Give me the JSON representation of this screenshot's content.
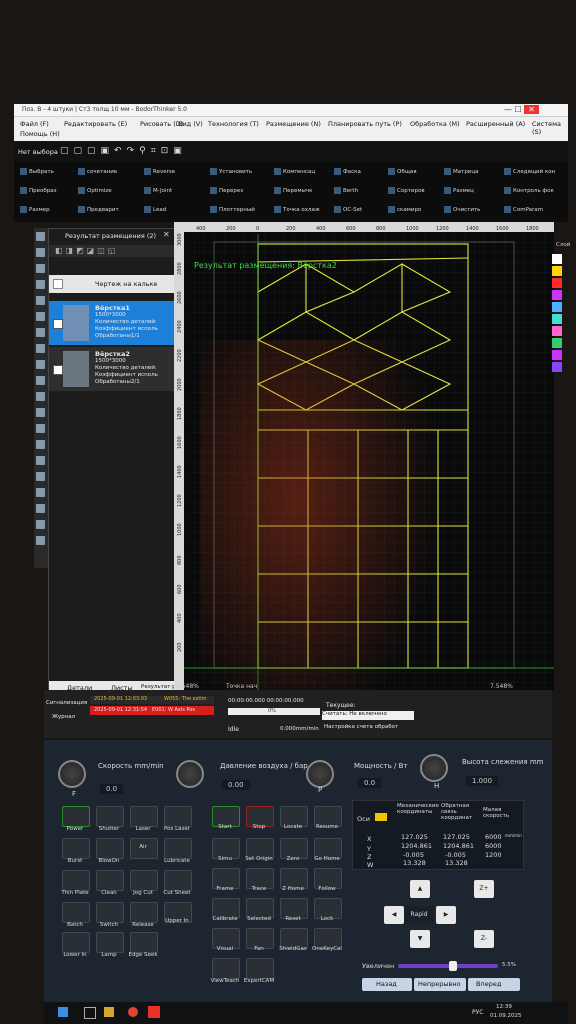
{
  "window_title": "Поз. В - 4 штуки | Ст3 толщ 10 мм - BodorThinker 5.0",
  "menu": [
    "Файл (F)",
    "Редактировать (E)",
    "Рисовать (D)",
    "Вид (V)",
    "Технология (T)",
    "Размещение (N)",
    "Планировать путь (P)",
    "Обработка (M)",
    "Расширенный (A)",
    "Система (S)",
    "Помощь (H)"
  ],
  "toolbar1": {
    "selection_label": "Нет выбора"
  },
  "ribbon": [
    [
      "Выбрать",
      "сочетание",
      "Reverse",
      "Установить",
      "Компенсац",
      "Фаска",
      "Общая",
      "Матрица",
      "Следящий кон"
    ],
    [
      "Преобраз",
      "Optimize",
      "M-Joint",
      "Перерез",
      "Перемычк",
      "Berth",
      "Сортиров",
      "Размец",
      "Контроль фок"
    ],
    [
      "Размер",
      "Предварит",
      "Lead",
      "Плоттерный",
      "Точка охлаж",
      "OC-Set",
      "скамиро",
      "Очистить",
      "ComParam"
    ]
  ],
  "panel": {
    "title": "Результат размещения (2)",
    "header": "Чертеж на кальке",
    "items": [
      {
        "name": "Вёрстка1",
        "size": "1500*3000",
        "detail": "Количество деталей:",
        "coef": "Коэффициент исполь",
        "status": "Обработаны1/1"
      },
      {
        "name": "Вёрстка2",
        "size": "1500*3000",
        "detail": "Количество деталей:",
        "coef": "Коэффициент исполь",
        "status": "Обработаны2/1"
      }
    ],
    "tabs": [
      "Детали",
      "Листы",
      "Результат размещ"
    ]
  },
  "canvas": {
    "overlay_title": "Результат размещения: Вёрстка2",
    "ruler_top": [
      "400",
      "200",
      "0",
      "200",
      "400",
      "600",
      "800",
      "1000",
      "1200",
      "1400",
      "1600",
      "1800"
    ],
    "ruler_left": [
      "3000",
      "2800",
      "2600",
      "2400",
      "2200",
      "2000",
      "1800",
      "1600",
      "1400",
      "1200",
      "1000",
      "800",
      "600",
      "400",
      "200"
    ],
    "zoom": "7.548%",
    "status_point_label": "Точка нач",
    "palette_label": "Слой"
  },
  "palette_colors": [
    "#ffffff",
    "#ffd400",
    "#ff2a2a",
    "#cc33ff",
    "#4ab0ff",
    "#40e0d0",
    "#ff66cc",
    "#33cc66",
    "#cc33ff",
    "#8844ff"
  ],
  "console": {
    "tabs": [
      "Сигнализация",
      "Журнал"
    ],
    "alarms": [
      "2025-09-01 12:03:03",
      "W055: The estim"
    ],
    "alarm_selected": "2025-09-01 12:31:54",
    "alarm_code": "E001: W Axis Pos",
    "timer": "00:00:00.000 00:00:00.000",
    "progress": "0%",
    "state": "Idle",
    "speed_readout": "0.000mm/min",
    "current_label": "Текущее:",
    "count_label": "Считать: Не включено",
    "setup_label": "Настройка счета обработ"
  },
  "gauges": [
    {
      "label": "Скорость mm/min",
      "value": "0.0",
      "letter": "F"
    },
    {
      "label": "Давление воздуха / бар",
      "value": "0.00",
      "letter": ""
    },
    {
      "label": "Мощность / Вт",
      "value": "0.0",
      "letter": "P"
    },
    {
      "label": "Высота слежения mm",
      "value": "1.000",
      "letter": "H"
    }
  ],
  "buttons_left": [
    [
      "Power",
      "Shutter",
      "Laser",
      "Pos Laser"
    ],
    [
      "Burst",
      "BlowOn",
      "Air",
      "Lubricate"
    ],
    [
      "Thin Plate",
      "Clean",
      "Jog Cut",
      "Cut Sheet"
    ],
    [
      "Batch",
      "Switch",
      "Release",
      "Upper In"
    ],
    [
      "Lower In",
      "Lamp",
      "Edge Seek",
      ""
    ]
  ],
  "buttons_right": [
    [
      "Start",
      "Stop",
      "Locate",
      "Resume"
    ],
    [
      "Simu",
      "Set Origin",
      "Zero",
      "Go Home"
    ],
    [
      "Frame",
      "Trace",
      "Z Home",
      "Follow"
    ],
    [
      "Calibrate",
      "Selected",
      "Reset",
      "Lock"
    ],
    [
      "Visual",
      "Fan",
      "ShieldGas",
      "OneKeyCal"
    ],
    [
      "ViewTeach",
      "ExpertCAM",
      "",
      ""
    ]
  ],
  "coords": {
    "headers": [
      "Оси",
      "Механические координаты",
      "Обратная связь координат",
      "Малая скорость"
    ],
    "rows": [
      {
        "axis": "X",
        "mech": "127.025",
        "fb": "127.025",
        "speed": "6000"
      },
      {
        "axis": "Y",
        "mech": "1204.861",
        "fb": "1204.861",
        "speed": "6000"
      },
      {
        "axis": "Z",
        "mech": "-0.005",
        "fb": "-0.005",
        "speed": "1200"
      },
      {
        "axis": "W",
        "mech": "13.328",
        "fb": "13.328",
        "speed": ""
      }
    ],
    "speed_unit": "mm/min"
  },
  "jog": {
    "center": "Rapid",
    "zplus": "Z+",
    "zminus": "Z-"
  },
  "zoom_slider": {
    "label": "Увеличен",
    "value": "5.5%",
    "fraction": 0.55
  },
  "nav": {
    "back": "Назад",
    "cont": "Непрерывно",
    "fwd": "Вперед"
  },
  "taskbar": {
    "lang": "РУС",
    "time": "12:39",
    "date": "01.09.2025"
  }
}
